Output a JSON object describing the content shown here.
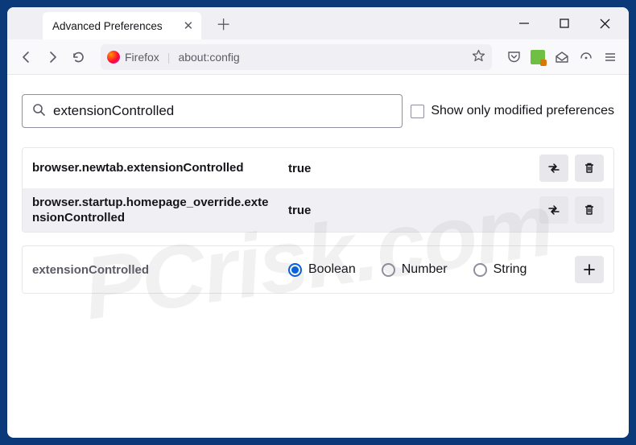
{
  "tab": {
    "title": "Advanced Preferences"
  },
  "urlbar": {
    "identity": "Firefox",
    "url": "about:config"
  },
  "search": {
    "value": "extensionControlled"
  },
  "filter": {
    "show_modified_label": "Show only modified preferences"
  },
  "prefs": [
    {
      "name": "browser.newtab.extensionControlled",
      "value": "true"
    },
    {
      "name": "browser.startup.homepage_override.extensionControlled",
      "value": "true"
    }
  ],
  "new_pref": {
    "name": "extensionControlled",
    "types": {
      "boolean": "Boolean",
      "number": "Number",
      "string": "String"
    }
  },
  "watermark": "PCrisk.com"
}
